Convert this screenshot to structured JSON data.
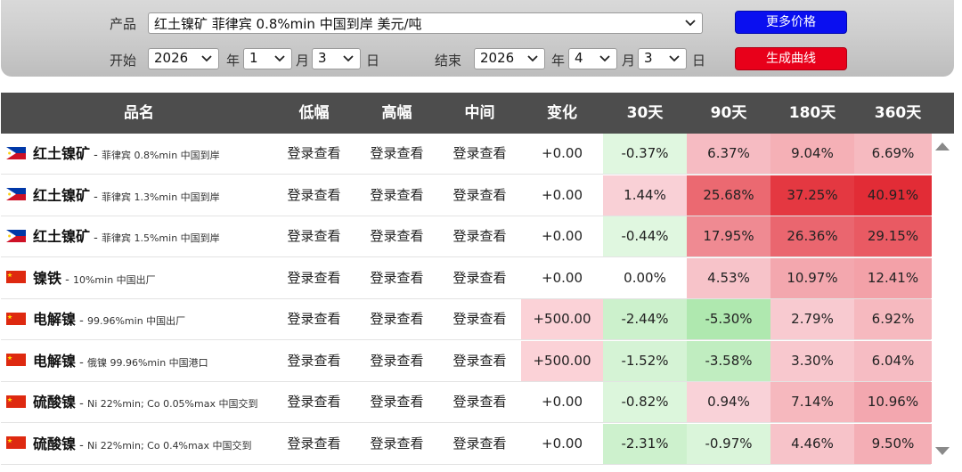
{
  "controls": {
    "product_label": "产品",
    "product_value": "红土镍矿 菲律宾 0.8%min 中国到岸 美元/吨",
    "start_label": "开始",
    "end_label": "结束",
    "year_unit": "年",
    "month_unit": "月",
    "day_unit": "日",
    "start": {
      "year": "2026",
      "month": "1",
      "day": "3"
    },
    "end": {
      "year": "2026",
      "month": "4",
      "day": "3"
    },
    "more_prices_label": "更多价格",
    "generate_curve_label": "生成曲线"
  },
  "columns": [
    "品名",
    "低幅",
    "高幅",
    "中间",
    "变化",
    "30天",
    "90天",
    "180天",
    "360天"
  ],
  "login_text": "登录查看",
  "rows": [
    {
      "flag": "philippines",
      "name": "红土镍矿",
      "desc": "菲律宾 0.8%min 中国到岸",
      "change": "+0.00",
      "d30": "-0.37%",
      "d90": "6.37%",
      "d180": "9.04%",
      "d360": "6.69%"
    },
    {
      "flag": "philippines",
      "name": "红土镍矿",
      "desc": "菲律宾 1.3%min 中国到岸",
      "change": "+0.00",
      "d30": "1.44%",
      "d90": "25.68%",
      "d180": "37.25%",
      "d360": "40.91%"
    },
    {
      "flag": "philippines",
      "name": "红土镍矿",
      "desc": "菲律宾 1.5%min 中国到岸",
      "change": "+0.00",
      "d30": "-0.44%",
      "d90": "17.95%",
      "d180": "26.36%",
      "d360": "29.15%"
    },
    {
      "flag": "china",
      "name": "镍铁",
      "desc": "10%min 中国出厂",
      "change": "+0.00",
      "d30": "0.00%",
      "d90": "4.53%",
      "d180": "10.97%",
      "d360": "12.41%"
    },
    {
      "flag": "china",
      "name": "电解镍",
      "desc": "99.96%min 中国出厂",
      "change": "+500.00",
      "d30": "-2.44%",
      "d90": "-5.30%",
      "d180": "2.79%",
      "d360": "6.92%"
    },
    {
      "flag": "china",
      "name": "电解镍",
      "desc": "俄镍 99.96%min 中国港口",
      "change": "+500.00",
      "d30": "-1.52%",
      "d90": "-3.58%",
      "d180": "3.30%",
      "d360": "6.04%"
    },
    {
      "flag": "china",
      "name": "硫酸镍",
      "desc": "Ni 22%min; Co 0.05%max 中国交到",
      "change": "+0.00",
      "d30": "-0.82%",
      "d90": "0.94%",
      "d180": "7.14%",
      "d360": "10.96%"
    },
    {
      "flag": "china",
      "name": "硫酸镍",
      "desc": "Ni 22%min; Co 0.4%max 中国交到",
      "change": "+0.00",
      "d30": "-2.31%",
      "d90": "-0.97%",
      "d180": "4.46%",
      "d360": "9.50%"
    }
  ],
  "colors": {
    "header_bg": "#4d4d4d",
    "change_up": "#fbd2d7",
    "neg_light": "#d9f5d9",
    "pos_scale_low": "#fbd3d8",
    "pos_scale_high": "#e2333f"
  },
  "icons": {
    "select_arrow": "chevron-down-icon",
    "scroll_up": "triangle-up-icon",
    "scroll_down": "triangle-down-icon",
    "flags": [
      "flag-philippines-icon",
      "flag-china-icon"
    ]
  }
}
